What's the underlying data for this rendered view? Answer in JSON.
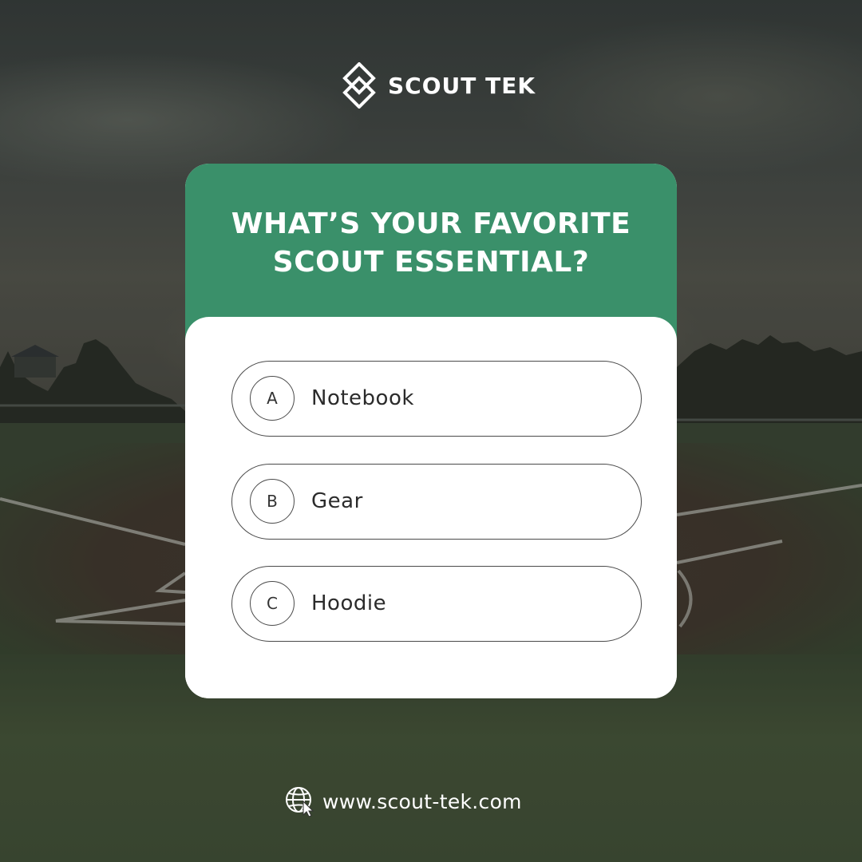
{
  "brand": {
    "name": "SCOUT TEK",
    "logo_icon": "scout-tek-logo-icon"
  },
  "poll": {
    "question_lines": [
      "WHAT’S YOUR FAVORITE",
      "SCOUT ESSENTIAL?"
    ],
    "options": [
      {
        "letter": "A",
        "label": "Notebook"
      },
      {
        "letter": "B",
        "label": "Gear"
      },
      {
        "letter": "C",
        "label": "Hoodie"
      }
    ]
  },
  "footer": {
    "website": "www.scout-tek.com",
    "icon": "globe-cursor-icon"
  },
  "colors": {
    "header_green": "#3a906a",
    "card_background": "#ffffff",
    "option_border": "#4a4a4a",
    "text_white": "#ffffff"
  }
}
